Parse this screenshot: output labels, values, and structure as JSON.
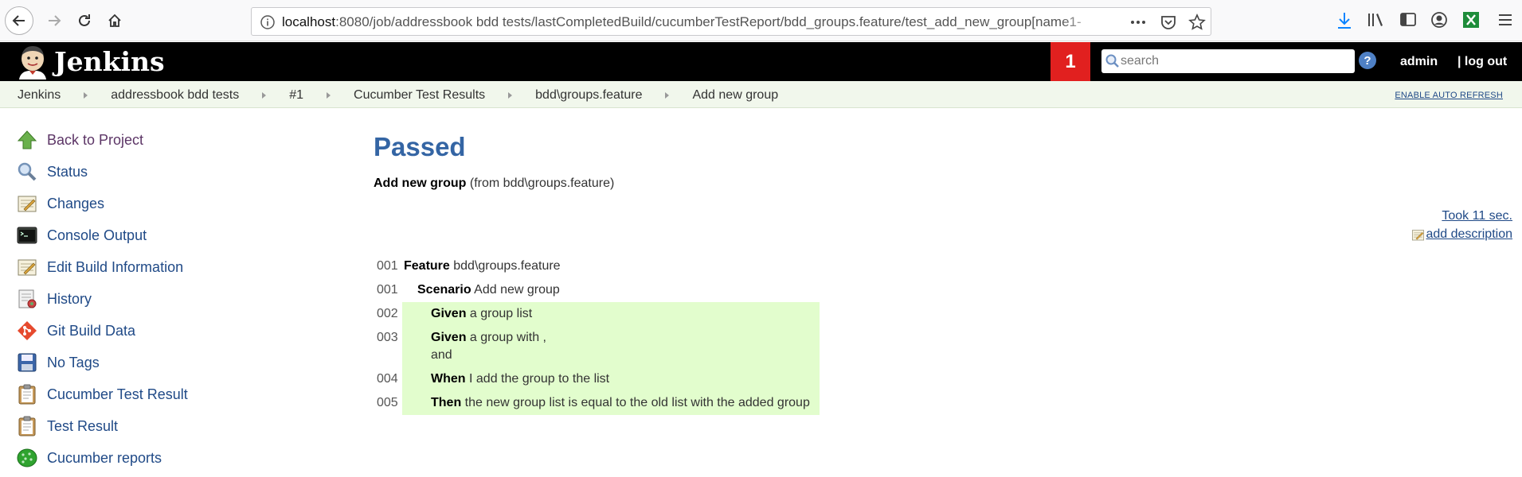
{
  "browser": {
    "url_host": "localhost",
    "url_rest": ":8080/job/addressbook bdd tests/lastCompletedBuild/cucumberTestReport/bdd_groups.feature/test_add_new_group[name1-"
  },
  "header": {
    "logo_text": "Jenkins",
    "notification_count": "1",
    "search_placeholder": "search",
    "help": "?",
    "user": "admin",
    "logout": "| log out"
  },
  "breadcrumbs": [
    "Jenkins",
    "addressbook bdd tests",
    "#1",
    "Cucumber Test Results",
    "bdd\\groups.feature",
    "Add new group"
  ],
  "auto_refresh": "ENABLE AUTO REFRESH",
  "sidebar": {
    "items": [
      {
        "label": "Back to Project",
        "icon": "up-arrow-icon"
      },
      {
        "label": "Status",
        "icon": "magnifier-icon"
      },
      {
        "label": "Changes",
        "icon": "notepad-icon"
      },
      {
        "label": "Console Output",
        "icon": "terminal-icon"
      },
      {
        "label": "Edit Build Information",
        "icon": "notepad-edit-icon"
      },
      {
        "label": "History",
        "icon": "history-icon"
      },
      {
        "label": "Git Build Data",
        "icon": "git-icon"
      },
      {
        "label": "No Tags",
        "icon": "save-icon"
      },
      {
        "label": "Cucumber Test Result",
        "icon": "clipboard-icon"
      },
      {
        "label": "Test Result",
        "icon": "clipboard-icon"
      },
      {
        "label": "Cucumber reports",
        "icon": "cucumber-icon"
      }
    ]
  },
  "main": {
    "status": "Passed",
    "test_name": "Add new group",
    "test_from": "(from bdd\\groups.feature)",
    "took": "Took 11 sec.",
    "add_description": "add description",
    "feature": {
      "line": "001",
      "keyword": "Feature",
      "text": "bdd\\groups.feature"
    },
    "scenario": {
      "line": "001",
      "keyword": "Scenario",
      "text": "Add new group"
    },
    "steps": [
      {
        "line": "002",
        "keyword": "Given",
        "text": "a group list",
        "extra": ""
      },
      {
        "line": "003",
        "keyword": "Given",
        "text": "a group with ,",
        "extra": "and"
      },
      {
        "line": "004",
        "keyword": "When",
        "text": "I add the group to the list",
        "extra": ""
      },
      {
        "line": "005",
        "keyword": "Then",
        "text": "the new group list is equal to the old list with the added group",
        "extra": ""
      }
    ]
  },
  "colors": {
    "header_bg": "#000000",
    "badge_red": "#e1201f",
    "title_blue": "#3465a4",
    "link_blue": "#204a87",
    "passed_green": "#e2fdcd",
    "breadcrumb_bg": "#f1f7ec"
  }
}
